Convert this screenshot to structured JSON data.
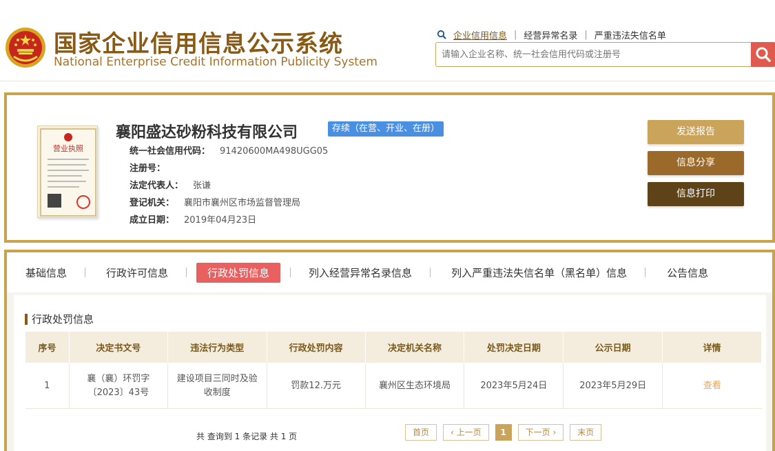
{
  "header": {
    "title_cn": "国家企业信用信息公示系统",
    "title_en": "National Enterprise Credit Information Publicity System",
    "links": [
      "企业信用信息",
      "经营异常名录",
      "严重违法失信名单"
    ],
    "search_placeholder": "请输入企业名称、统一社会信用代码或注册号",
    "search_icon": "search-icon"
  },
  "company": {
    "name": "襄阳盛达砂粉科技有限公司",
    "status": "存续（在营、开业、在册）",
    "fields": [
      {
        "key": "统一社会信用代码：",
        "value": "91420600MA498UGG05"
      },
      {
        "key": "注册号：",
        "value": ""
      },
      {
        "key": "法定代表人：",
        "value": "张谦"
      },
      {
        "key": "登记机关：",
        "value": "襄阳市襄州区市场监督管理局"
      },
      {
        "key": "成立日期：",
        "value": "2019年04月23日"
      }
    ],
    "buttons": [
      "发送报告",
      "信息分享",
      "信息打印"
    ],
    "license_label": "营业执照"
  },
  "tabs": [
    {
      "label": "基础信息",
      "active": false
    },
    {
      "label": "行政许可信息",
      "active": false
    },
    {
      "label": "行政处罚信息",
      "active": true
    },
    {
      "label": "列入经营异常名录信息",
      "active": false
    },
    {
      "label": "列入严重违法失信名单（黑名单）信息",
      "active": false
    },
    {
      "label": "公告信息",
      "active": false
    }
  ],
  "section": {
    "title": "行政处罚信息",
    "columns": [
      "序号",
      "决定书文号",
      "违法行为类型",
      "行政处罚内容",
      "决定机关名称",
      "处罚决定日期",
      "公示日期",
      "详情"
    ],
    "rows": [
      [
        "1",
        "襄（襄）环罚字〔2023〕43号",
        "建设项目三同时及验收制度",
        "罚款12.万元",
        "襄州区生态环境局",
        "2023年5月24日",
        "2023年5月29日",
        "查看"
      ]
    ],
    "summary": "共 查询到 1 条记录 共 1 页",
    "pager": {
      "first": "首页",
      "prev": "上一页",
      "current": "1",
      "next": "下一页",
      "last": "末页"
    }
  },
  "colors": {
    "accent": "#c9a24a",
    "active_tab": "#e86060",
    "status_badge": "#4a90e2"
  }
}
